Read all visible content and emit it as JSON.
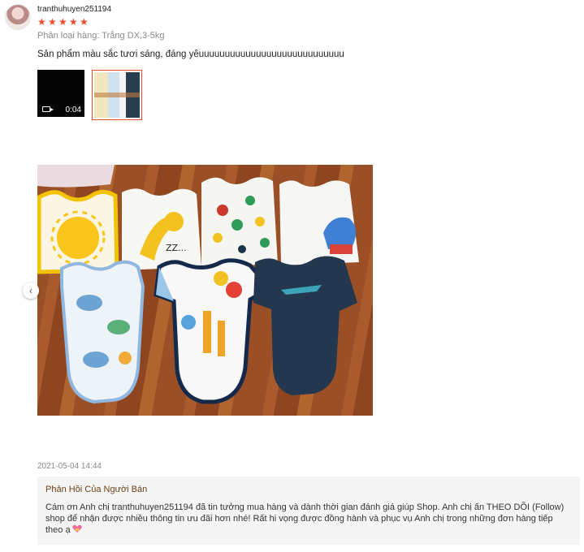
{
  "review": {
    "username": "tranthuhuyen251194",
    "rating": 5,
    "star_glyph": "★",
    "variant": "Phân loại hàng: Trắng DX,3-5kg",
    "comment": "Sản phẩm màu sắc tươi sáng, đáng yêuuuuuuuuuuuuuuuuuuuuuuuuuuuu",
    "media": {
      "video_duration": "0:04",
      "video_icon": "video-camera-icon",
      "selected_index": 1
    },
    "photo_nav_icon": "chevron-left-icon",
    "photo_nav_glyph": "‹",
    "timestamp": "2021-05-04 14:44"
  },
  "seller_reply": {
    "title": "Phản Hồi Của Người Bán",
    "text": "Cám ơn Anh chị tranthuhuyen251194 đã tin tưởng mua hàng và dành thời gian đánh giá giúp Shop. Anh chị ấn THEO DÕI (Follow) shop để nhận được nhiều thông tin ưu đãi hơn nhé! Rất hi vọng được đồng hành và phục vụ Anh chị trong những đơn hàng tiếp theo ạ",
    "emoji_icon": "heart-gift-icon"
  },
  "colors": {
    "accent": "#ee4d2d",
    "reply_title": "#6b3f16",
    "muted": "#8a8a8a",
    "reply_bg": "#f5f5f5"
  }
}
